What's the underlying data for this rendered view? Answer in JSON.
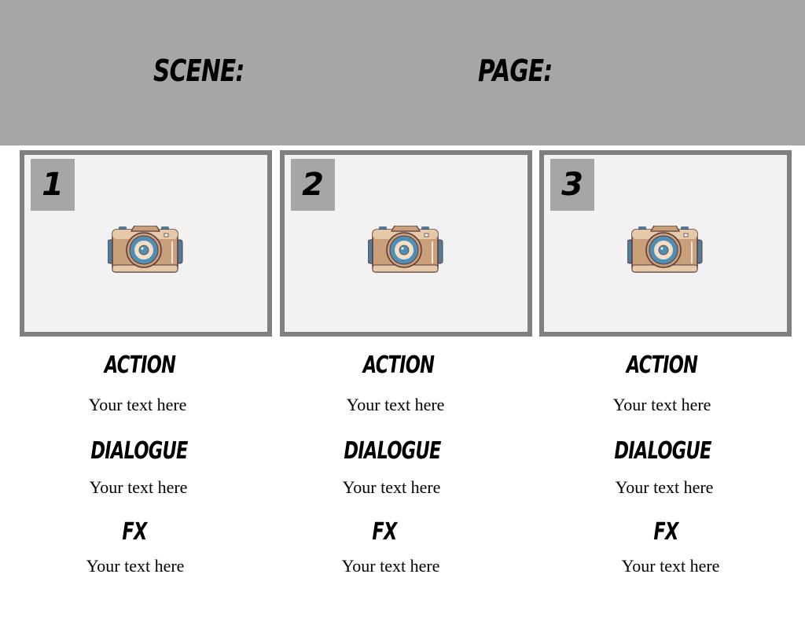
{
  "header": {
    "scene_label": "SCENE:",
    "page_label": "PAGE:",
    "background": "#a6a6a6"
  },
  "panels": [
    {
      "number": "1",
      "action_label": "ACTION",
      "action_text": "Your text here",
      "dialogue_label": "DIALOGUE",
      "dialogue_text": "Your text here",
      "fx_label": "FX",
      "fx_text": "Your text here",
      "icon": "camera-icon"
    },
    {
      "number": "2",
      "action_label": "ACTION",
      "action_text": "Your text here",
      "dialogue_label": "DIALOGUE",
      "dialogue_text": "Your text here",
      "fx_label": "FX",
      "fx_text": "Your text here",
      "icon": "camera-icon"
    },
    {
      "number": "3",
      "action_label": "ACTION",
      "action_text": "Your text here",
      "dialogue_label": "DIALOGUE",
      "dialogue_text": "Your text here",
      "fx_label": "FX",
      "fx_text": "Your text here",
      "icon": "camera-icon"
    }
  ],
  "colors": {
    "panel_border": "#808080",
    "panel_fill": "#f2f2f2",
    "number_box": "#a6a6a6"
  }
}
